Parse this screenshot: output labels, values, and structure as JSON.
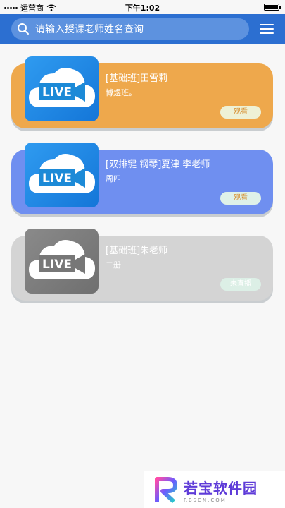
{
  "status_bar": {
    "carrier": "运营商",
    "time": "下午1:02"
  },
  "header": {
    "search_placeholder": "请输入授课老师姓名查询"
  },
  "colors": {
    "header_bg": "#2c6fd1",
    "orange_card": "#eea84c",
    "blue_card": "#6f8ff0",
    "gray_card": "#d4d4d4"
  },
  "classes": [
    {
      "title": "[基础班]田雪莉",
      "subtitle": "博煜班。",
      "action": "观看",
      "state": "live",
      "thumb_icon": "live-cloud-icon"
    },
    {
      "title": "[双排键 钢琴]夏津 李老师",
      "subtitle": "周四",
      "action": "观看",
      "state": "live",
      "thumb_icon": "live-cloud-icon"
    },
    {
      "title": "[基础班]朱老师",
      "subtitle": "二册",
      "action": "未直播",
      "state": "not-live",
      "thumb_icon": "live-cloud-icon"
    }
  ],
  "live_label": "LIVE",
  "watermark": {
    "name": "若宝软件园",
    "url": "RBSCN.COM"
  }
}
